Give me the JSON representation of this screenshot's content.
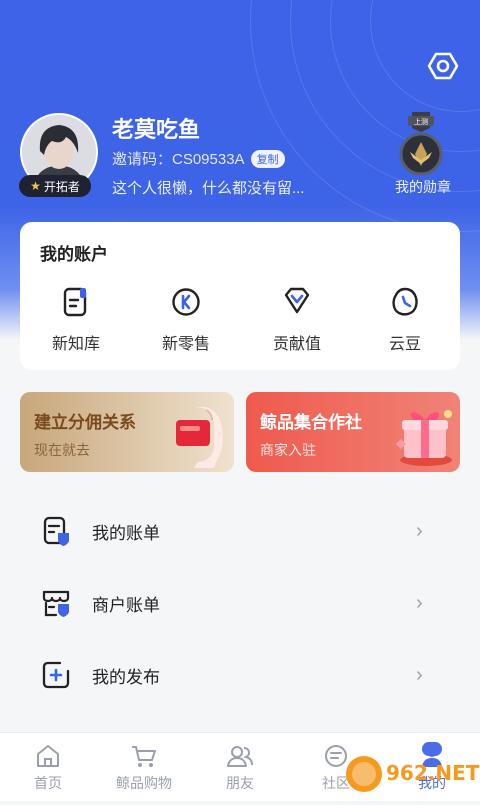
{
  "profile": {
    "username": "老莫吃鱼",
    "invite_label": "邀请码：CS09533A",
    "copy_label": "复制",
    "badge_label": "开拓者",
    "bio": "这个人很懒，什么都没有留...",
    "medal_label": "我的勋章",
    "medal_ribbon": "上测"
  },
  "account": {
    "title": "我的账户",
    "items": [
      {
        "label": "新知库",
        "icon": "book-icon"
      },
      {
        "label": "新零售",
        "icon": "k-coin-icon"
      },
      {
        "label": "贡献值",
        "icon": "diamond-icon"
      },
      {
        "label": "云豆",
        "icon": "bean-icon"
      }
    ]
  },
  "promos": [
    {
      "title": "建立分佣关系",
      "subtitle": "现在就去"
    },
    {
      "title": "鲸品集合作社",
      "subtitle": "商家入驻"
    }
  ],
  "menu": [
    {
      "label": "我的账单",
      "icon": "bill-icon"
    },
    {
      "label": "商户账单",
      "icon": "shop-bill-icon"
    },
    {
      "label": "我的发布",
      "icon": "publish-icon"
    }
  ],
  "tabs": [
    {
      "label": "首页",
      "icon": "home-icon"
    },
    {
      "label": "鲸品购物",
      "icon": "cart-icon"
    },
    {
      "label": "朋友",
      "icon": "friends-icon"
    },
    {
      "label": "社区",
      "icon": "community-icon"
    },
    {
      "label": "我的",
      "icon": "me-icon"
    }
  ],
  "watermark": "962.NET 乐游网",
  "colors": {
    "accent": "#3d63e6",
    "promo_right": "#ef5a4e"
  }
}
